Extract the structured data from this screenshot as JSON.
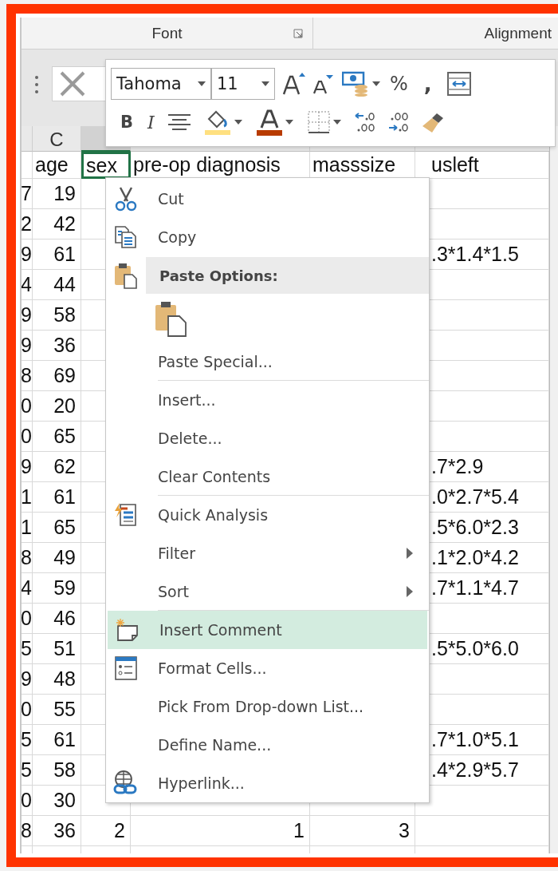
{
  "ribbon": {
    "groups": [
      {
        "label": "Font",
        "launcher": true
      },
      {
        "label": "Alignment",
        "launcher": false
      }
    ]
  },
  "mini_toolbar": {
    "font": "Tahoma",
    "size": "11",
    "percent": "%",
    "comma": ",",
    "bold": "B",
    "italic": "I"
  },
  "sheet": {
    "column_headers": [
      {
        "label": "C",
        "selected": false
      },
      {
        "selected": true
      }
    ],
    "header_row": [
      {
        "text": "age",
        "selected": false
      },
      {
        "text": "sex",
        "selected": true
      },
      {
        "text": "pre-op diagnosis",
        "selected": false
      },
      {
        "text": "masssize",
        "selected": false
      },
      {
        "text": "usleft",
        "selected": false
      }
    ],
    "rows": [
      {
        "column_b": "7",
        "age": "19"
      },
      {
        "column_b": "2",
        "age": "42"
      },
      {
        "column_b": "9",
        "age": "61",
        "usleft": ".3*1.4*1.5"
      },
      {
        "column_b": "4",
        "age": "44"
      },
      {
        "column_b": "9",
        "age": "58"
      },
      {
        "column_b": "9",
        "age": "36"
      },
      {
        "column_b": "8",
        "age": "69"
      },
      {
        "column_b": "0",
        "age": "20"
      },
      {
        "column_b": "0",
        "age": "65"
      },
      {
        "column_b": "9",
        "age": "62",
        "usleft": ".7*2.9"
      },
      {
        "column_b": "1",
        "age": "61",
        "usleft": ".0*2.7*5.4"
      },
      {
        "column_b": "1",
        "age": "65",
        "usleft": ".5*6.0*2.3"
      },
      {
        "column_b": "8",
        "age": "49",
        "usleft": ".1*2.0*4.2"
      },
      {
        "column_b": "4",
        "age": "59",
        "usleft": ".7*1.1*4.7"
      },
      {
        "column_b": "0",
        "age": "46"
      },
      {
        "column_b": "5",
        "age": "51",
        "usleft": ".5*5.0*6.0"
      },
      {
        "column_b": "9",
        "age": "48"
      },
      {
        "column_b": "0",
        "age": "55"
      },
      {
        "column_b": "5",
        "age": "61",
        "usleft": ".7*1.0*5.1"
      },
      {
        "column_b": "5",
        "age": "58",
        "usleft": ".4*2.9*5.7"
      },
      {
        "column_b": "0",
        "age": "30"
      },
      {
        "column_b": "8",
        "age": "36",
        "sex": "2",
        "pre_op_diagnosis": "1",
        "masssize": "3"
      }
    ]
  },
  "context_menu": {
    "items": [
      {
        "kind": "command",
        "label": "Cut",
        "selected": false,
        "submenu": false,
        "separator_after": false
      },
      {
        "kind": "command",
        "label": "Copy",
        "selected": false,
        "submenu": false,
        "separator_after": false
      },
      {
        "kind": "header",
        "label": "Paste Options:"
      },
      {
        "kind": "paste-buttons"
      },
      {
        "kind": "command",
        "label": "Paste Special...",
        "selected": false,
        "submenu": false,
        "separator_after": true
      },
      {
        "kind": "command",
        "label": "Insert...",
        "selected": false,
        "submenu": false,
        "separator_after": false
      },
      {
        "kind": "command",
        "label": "Delete...",
        "selected": false,
        "submenu": false,
        "separator_after": false
      },
      {
        "kind": "command",
        "label": "Clear Contents",
        "selected": false,
        "submenu": false,
        "separator_after": true
      },
      {
        "kind": "command",
        "label": "Quick Analysis",
        "selected": false,
        "submenu": false,
        "separator_after": false
      },
      {
        "kind": "command",
        "label": "Filter",
        "selected": false,
        "submenu": true,
        "separator_after": false
      },
      {
        "kind": "command",
        "label": "Sort",
        "selected": false,
        "submenu": true,
        "separator_after": true
      },
      {
        "kind": "command",
        "label": "Insert Comment",
        "selected": true,
        "submenu": false,
        "separator_after": false
      },
      {
        "kind": "command",
        "label": "Format Cells...",
        "selected": false,
        "submenu": false,
        "separator_after": false
      },
      {
        "kind": "command",
        "label": "Pick From Drop-down List...",
        "selected": false,
        "submenu": false,
        "separator_after": false
      },
      {
        "kind": "command",
        "label": "Define Name...",
        "selected": false,
        "submenu": false,
        "separator_after": false
      },
      {
        "kind": "command",
        "label": "Hyperlink...",
        "selected": false,
        "submenu": false,
        "separator_after": false
      }
    ]
  }
}
